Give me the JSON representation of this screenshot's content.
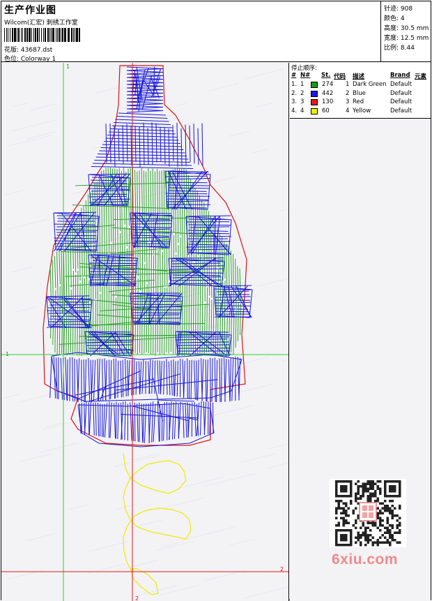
{
  "header": {
    "title": "生产作业图",
    "company": "Wilcom(汇宏) 刺绣工作室",
    "design_file": "花版:  43687.dst",
    "colorway": "色位:  Colorway 1"
  },
  "stats": [
    {
      "label": "针迹:",
      "value": "908"
    },
    {
      "label": "颜色:",
      "value": "4"
    },
    {
      "label": "高度:",
      "value": "30.5 mm"
    },
    {
      "label": "宽度:",
      "value": "12.5 mm"
    },
    {
      "label": "比例:",
      "value": "8.44"
    }
  ],
  "stop_sequence": {
    "title": "停止顺序:",
    "columns": [
      "#",
      "N#",
      "St.",
      "代码",
      "描述",
      "Brand",
      "元素"
    ],
    "rows": [
      {
        "index": "1.",
        "needle": "1",
        "color": "#1a9a1a",
        "stitches": "274",
        "code": "1",
        "description": "Dark Green",
        "brand": "Default"
      },
      {
        "index": "2.",
        "needle": "2",
        "color": "#1a1ae6",
        "stitches": "442",
        "code": "2",
        "description": "Blue",
        "brand": "Default"
      },
      {
        "index": "3.",
        "needle": "3",
        "color": "#e61a1a",
        "stitches": "130",
        "code": "3",
        "description": "Red",
        "brand": "Default"
      },
      {
        "index": "4.",
        "needle": "4",
        "color": "#f0f000",
        "stitches": "60",
        "code": "4",
        "description": "Yellow",
        "brand": "Default"
      }
    ]
  },
  "guides": {
    "vertical_start": "1",
    "vertical_end": "2",
    "horizontal_start": "1",
    "horizontal_end": "2"
  },
  "watermark": "6xiu.com",
  "colors": {
    "guide": "#2ad32a",
    "guide_end": "#e11b1b",
    "outline": "#dd1111",
    "green": "#1f9a1f",
    "blue": "#1616d8",
    "yellow": "#eded00",
    "canvas_bg": "#f3f2f5"
  }
}
